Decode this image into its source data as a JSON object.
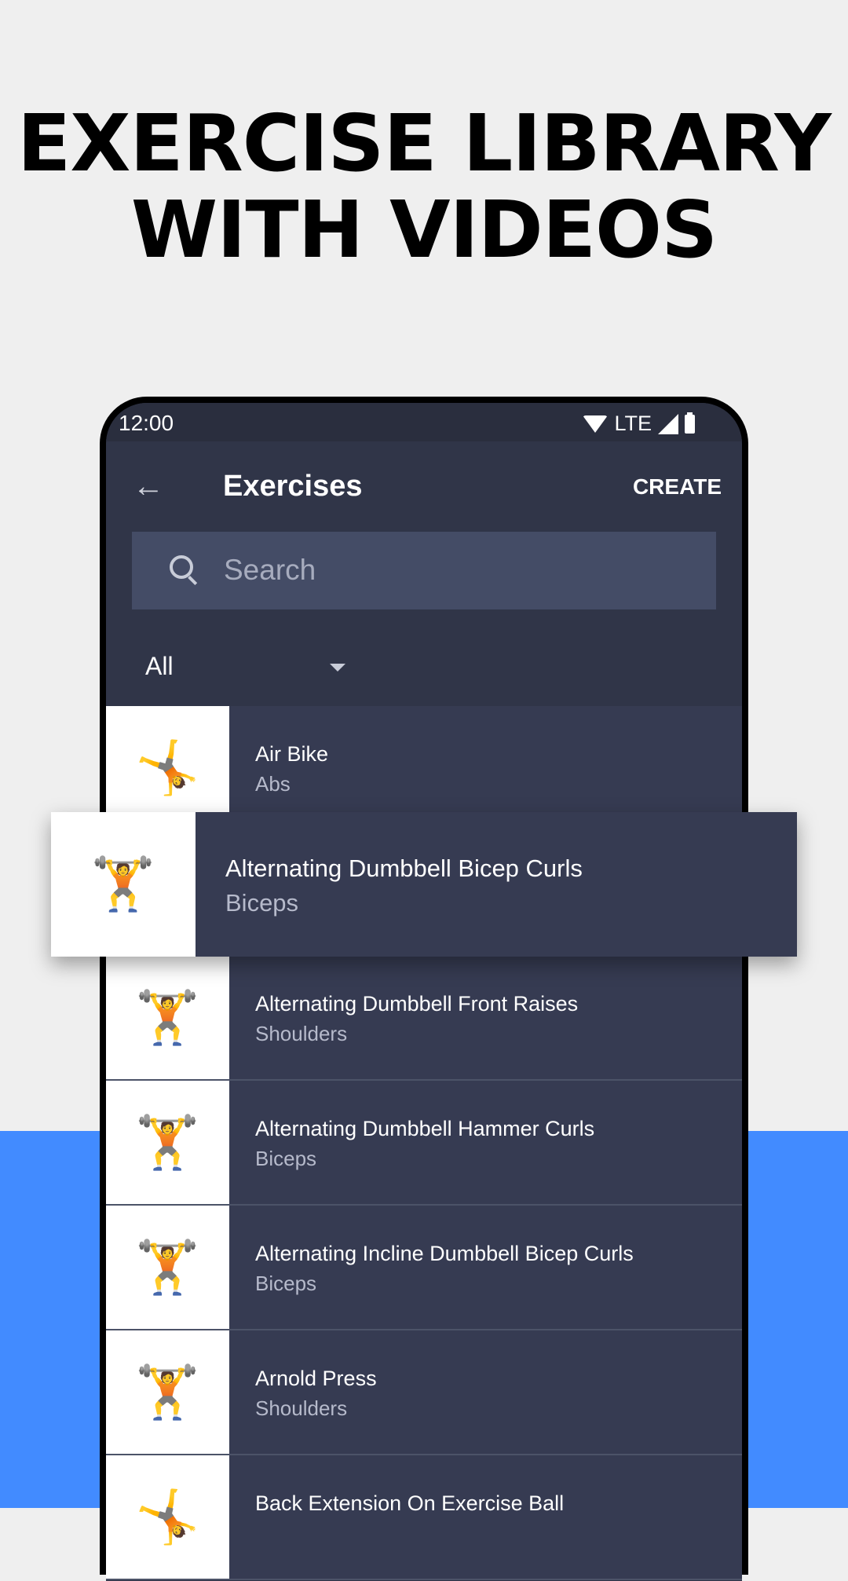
{
  "headline": {
    "line1": "EXERCISE LIBRARY",
    "line2": "WITH VIDEOS"
  },
  "status_bar": {
    "time": "12:00",
    "network": "LTE",
    "icons": [
      "wifi-icon",
      "signal-icon",
      "battery-icon"
    ]
  },
  "toolbar": {
    "back_icon": "arrow-left",
    "title": "Exercises",
    "create_label": "CREATE"
  },
  "search": {
    "placeholder": "Search",
    "value": ""
  },
  "filter": {
    "selected": "All"
  },
  "floating_item": {
    "name": "Alternating Dumbbell Bicep Curls",
    "category": "Biceps"
  },
  "exercises": [
    {
      "name": "Air Bike",
      "category": "Abs"
    },
    {
      "name": "Alternating Dumbbell Bicep Curls",
      "category": "Biceps"
    },
    {
      "name": "Alternating Dumbbell Front Raises",
      "category": "Shoulders"
    },
    {
      "name": "Alternating Dumbbell Hammer Curls",
      "category": "Biceps"
    },
    {
      "name": "Alternating Incline Dumbbell Bicep Curls",
      "category": "Biceps"
    },
    {
      "name": "Arnold Press",
      "category": "Shoulders"
    },
    {
      "name": "Back Extension On Exercise Ball",
      "category": ""
    }
  ],
  "colors": {
    "accent_blue": "#428bff",
    "screen_bg": "#303548",
    "row_bg": "#363b52",
    "search_bg": "#444c66"
  }
}
